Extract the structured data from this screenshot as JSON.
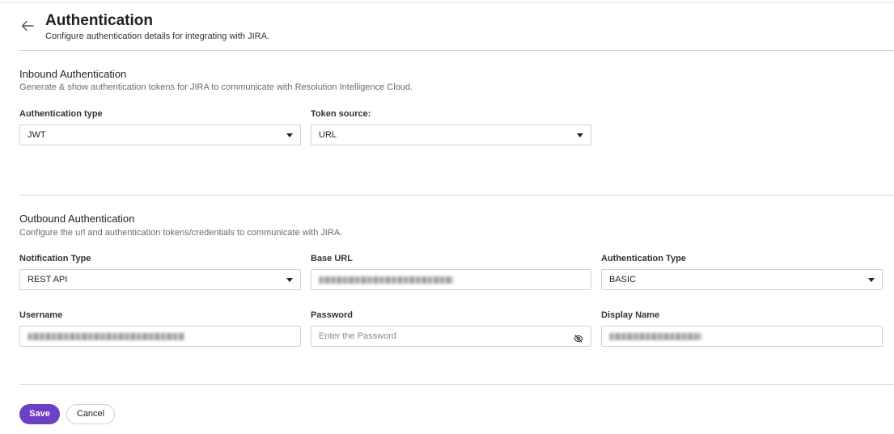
{
  "header": {
    "back_icon": "arrow-left-icon",
    "title": "Authentication",
    "subtitle": "Configure authentication details for integrating with JIRA."
  },
  "inbound": {
    "title": "Inbound Authentication",
    "description": "Generate & show authentication tokens for JIRA to communicate with Resolution Intelligence Cloud.",
    "auth_type": {
      "label": "Authentication type",
      "value": "JWT"
    },
    "token_source": {
      "label": "Token source:",
      "value": "URL"
    }
  },
  "outbound": {
    "title": "Outbound Authentication",
    "description": "Configure the url and authentication tokens/credentials to communicate with JIRA.",
    "notification_type": {
      "label": "Notification Type",
      "value": "REST API"
    },
    "base_url": {
      "label": "Base URL",
      "value": ""
    },
    "auth_type": {
      "label": "Authentication Type",
      "value": "BASIC"
    },
    "username": {
      "label": "Username",
      "value": ""
    },
    "password": {
      "label": "Password",
      "placeholder": "Enter the Password",
      "icon": "eye-off-icon"
    },
    "display_name": {
      "label": "Display Name",
      "value": ""
    }
  },
  "actions": {
    "save_label": "Save",
    "cancel_label": "Cancel"
  },
  "colors": {
    "accent": "#6c3fc4"
  }
}
